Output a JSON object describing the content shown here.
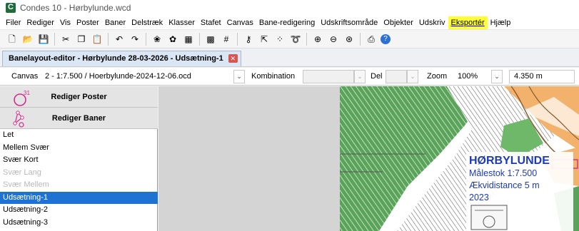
{
  "window": {
    "title": "Condes 10 - Hørbylunde.wcd"
  },
  "menu": [
    {
      "label": "Filer"
    },
    {
      "label": "Rediger"
    },
    {
      "label": "Vis"
    },
    {
      "label": "Poster"
    },
    {
      "label": "Baner"
    },
    {
      "label": "Delstræk"
    },
    {
      "label": "Klasser"
    },
    {
      "label": "Stafet"
    },
    {
      "label": "Canvas"
    },
    {
      "label": "Bane-redigering"
    },
    {
      "label": "Udskriftsområde"
    },
    {
      "label": "Objekter"
    },
    {
      "label": "Udskriv"
    },
    {
      "label": "Eksportér",
      "highlighted": true
    },
    {
      "label": "Hjælp"
    }
  ],
  "toolbar_icons": [
    "new-file-icon",
    "open-folder-icon",
    "save-icon",
    "|",
    "cut-icon",
    "copy-icon",
    "paste-icon",
    "|",
    "undo-icon",
    "redo-icon",
    "|",
    "add-control-icon",
    "add-course-icon",
    "table-icon",
    "|",
    "grid-icon",
    "grid-lines-icon",
    "|",
    "key-icon",
    "pointer-tool-icon",
    "scatter-icon",
    "lasso-icon",
    "|",
    "zoom-in-icon",
    "zoom-out-icon",
    "zoom-fit-icon",
    "|",
    "print-icon",
    "help-icon"
  ],
  "doc_tab": {
    "label": "Banelayout-editor - Hørbylunde 28-03-2026 - Udsætning-1"
  },
  "options": {
    "canvas_label": "Canvas",
    "canvas_value": "2 - 1:7.500 / Hoerbylunde-2024-12-06.ocd",
    "kombination_label": "Kombination",
    "del_label": "Del",
    "zoom_label": "Zoom",
    "zoom_value": "100%",
    "distance_value": "4.350 m"
  },
  "panel": {
    "edit_controls_label": "Rediger Poster",
    "edit_controls_number": "31",
    "edit_courses_label": "Rediger Baner",
    "items": [
      {
        "label": "Let"
      },
      {
        "label": "Mellem Svær"
      },
      {
        "label": "Svær Kort"
      },
      {
        "label": "Svær Lang",
        "dim": true
      },
      {
        "label": "Svær Mellem",
        "dim": true
      },
      {
        "label": "Udsætning-1",
        "selected": true
      },
      {
        "label": "Udsætning-2"
      },
      {
        "label": "Udsætning-3"
      }
    ]
  },
  "map": {
    "title": "HØRBYLUNDE",
    "scale": "Målestok 1:7.500",
    "contour": "Ækvidistance 5 m",
    "year": "2023"
  },
  "colors": {
    "selection": "#1e73d2",
    "highlight": "#ffff33",
    "map_title": "#1d3bb3",
    "control_magenta": "#d62a8b"
  }
}
